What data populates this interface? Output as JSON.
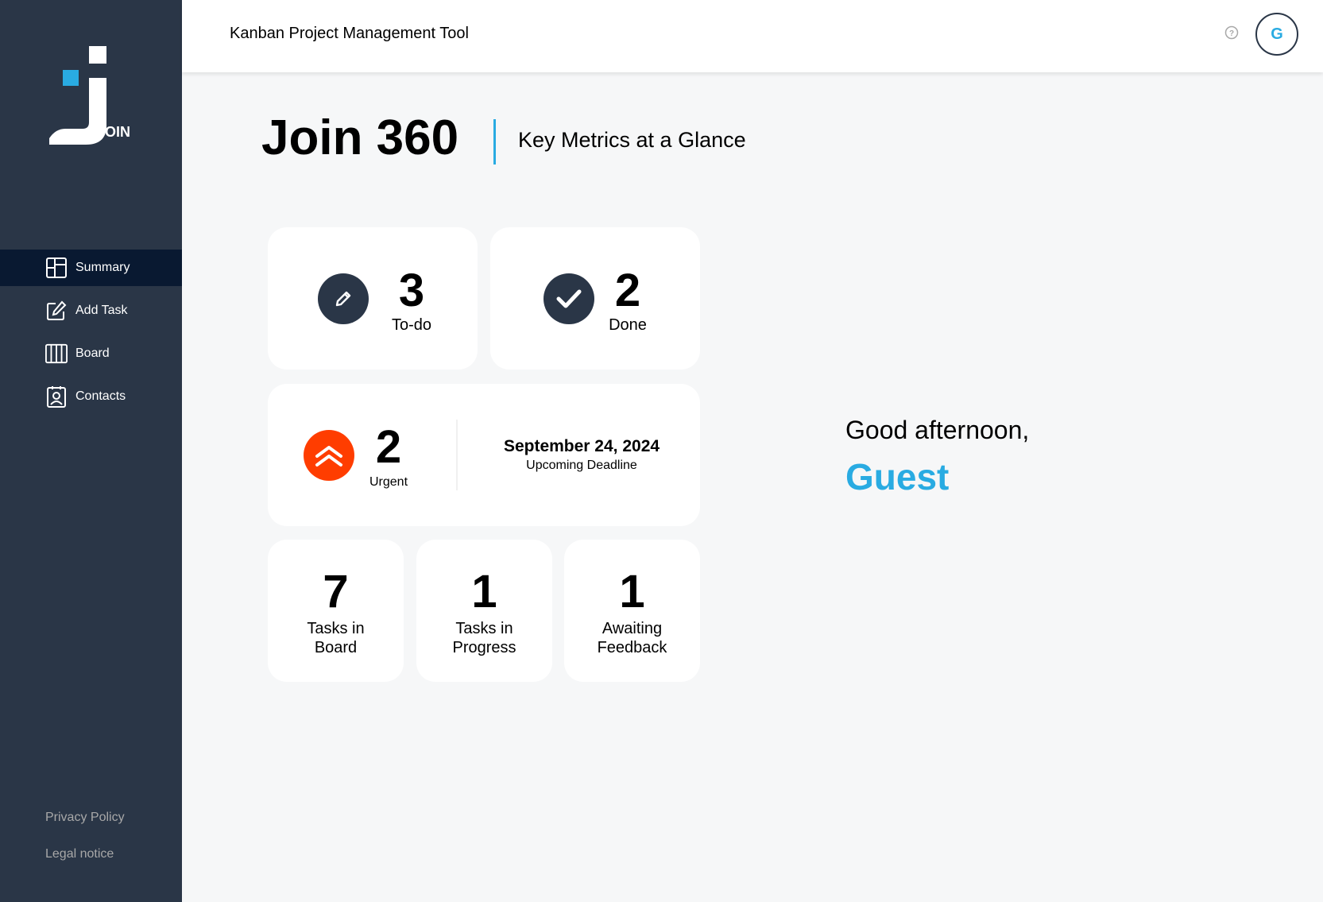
{
  "app": {
    "header_title": "Kanban Project Management Tool",
    "avatar_initial": "G"
  },
  "logo": {
    "text": "OIN"
  },
  "sidebar": {
    "items": [
      {
        "label": "Summary",
        "icon": "summary-icon",
        "active": true
      },
      {
        "label": "Add Task",
        "icon": "edit-icon",
        "active": false
      },
      {
        "label": "Board",
        "icon": "board-icon",
        "active": false
      },
      {
        "label": "Contacts",
        "icon": "contacts-icon",
        "active": false
      }
    ],
    "footer": {
      "privacy": "Privacy Policy",
      "legal": "Legal notice"
    }
  },
  "main": {
    "title": "Join 360",
    "subtitle": "Key Metrics at a Glance",
    "todo": {
      "count": "3",
      "label": "To-do"
    },
    "done": {
      "count": "2",
      "label": "Done"
    },
    "urgent": {
      "count": "2",
      "label": "Urgent"
    },
    "deadline": {
      "date": "September 24, 2024",
      "label": "Upcoming Deadline"
    },
    "board": {
      "count": "7",
      "label_line1": "Tasks in",
      "label_line2": "Board"
    },
    "progress": {
      "count": "1",
      "label_line1": "Tasks in",
      "label_line2": "Progress"
    },
    "feedback": {
      "count": "1",
      "label_line1": "Awaiting",
      "label_line2": "Feedback"
    },
    "greeting": "Good afternoon,",
    "user_name": "Guest"
  },
  "colors": {
    "sidebar_bg": "#2a3647",
    "active_item_bg": "#091931",
    "accent": "#29abe2",
    "urgent": "#ff3d00"
  }
}
